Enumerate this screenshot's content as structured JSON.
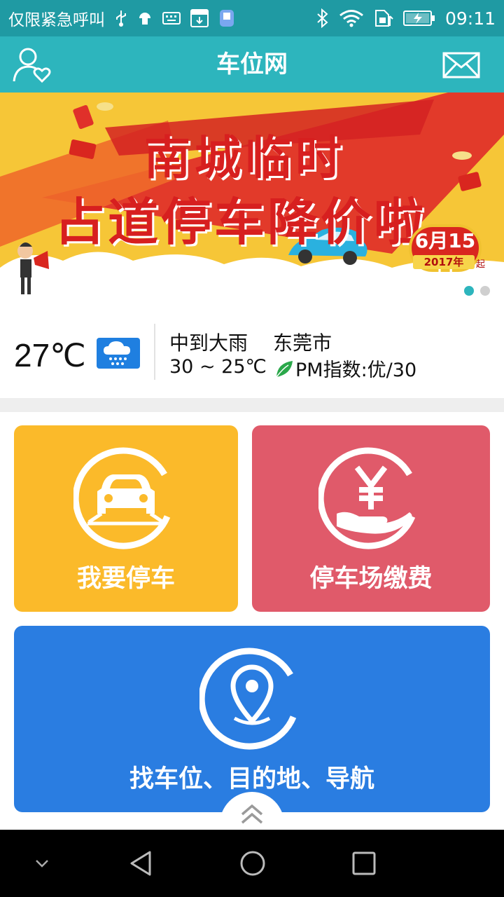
{
  "status_bar": {
    "carrier": "仅限紧急呼叫",
    "time": "09:11",
    "icons": [
      "usb-icon",
      "android-icon",
      "keyboard-icon",
      "download-icon",
      "sd-card-icon",
      "bluetooth-icon",
      "wifi-icon",
      "sim-icon",
      "battery-charging-icon"
    ]
  },
  "app_bar": {
    "title": "车位网",
    "left_icon": "user-heart-icon",
    "right_icon": "mail-icon"
  },
  "banner": {
    "line1": "南城临时",
    "line2": "占道停车降价啦",
    "date": "6月15日",
    "year": "2017年",
    "suffix": "起",
    "slide_count": 2,
    "active_slide": 1,
    "colors": {
      "background": "#f6c637",
      "headline": "#d71f1f"
    }
  },
  "weather": {
    "temperature": "27℃",
    "icon": "heavy-rain-icon",
    "condition": "中到大雨",
    "city": "东莞市",
    "range": "30 ~ 25℃",
    "pm_text": "PM指数:优/30",
    "pm_icon": "leaf-icon"
  },
  "tiles": [
    {
      "label": "我要停车",
      "icon": "car-icon",
      "color": "#fbba2a"
    },
    {
      "label": "停车场缴费",
      "icon": "yuan-hand-icon",
      "color": "#e05a6a"
    },
    {
      "label": "找车位、目的地、导航",
      "icon": "location-pin-icon",
      "color": "#2a7de1"
    }
  ],
  "nav_bar": {
    "buttons": [
      "collapse-icon",
      "back-icon",
      "home-icon",
      "recents-icon"
    ]
  }
}
